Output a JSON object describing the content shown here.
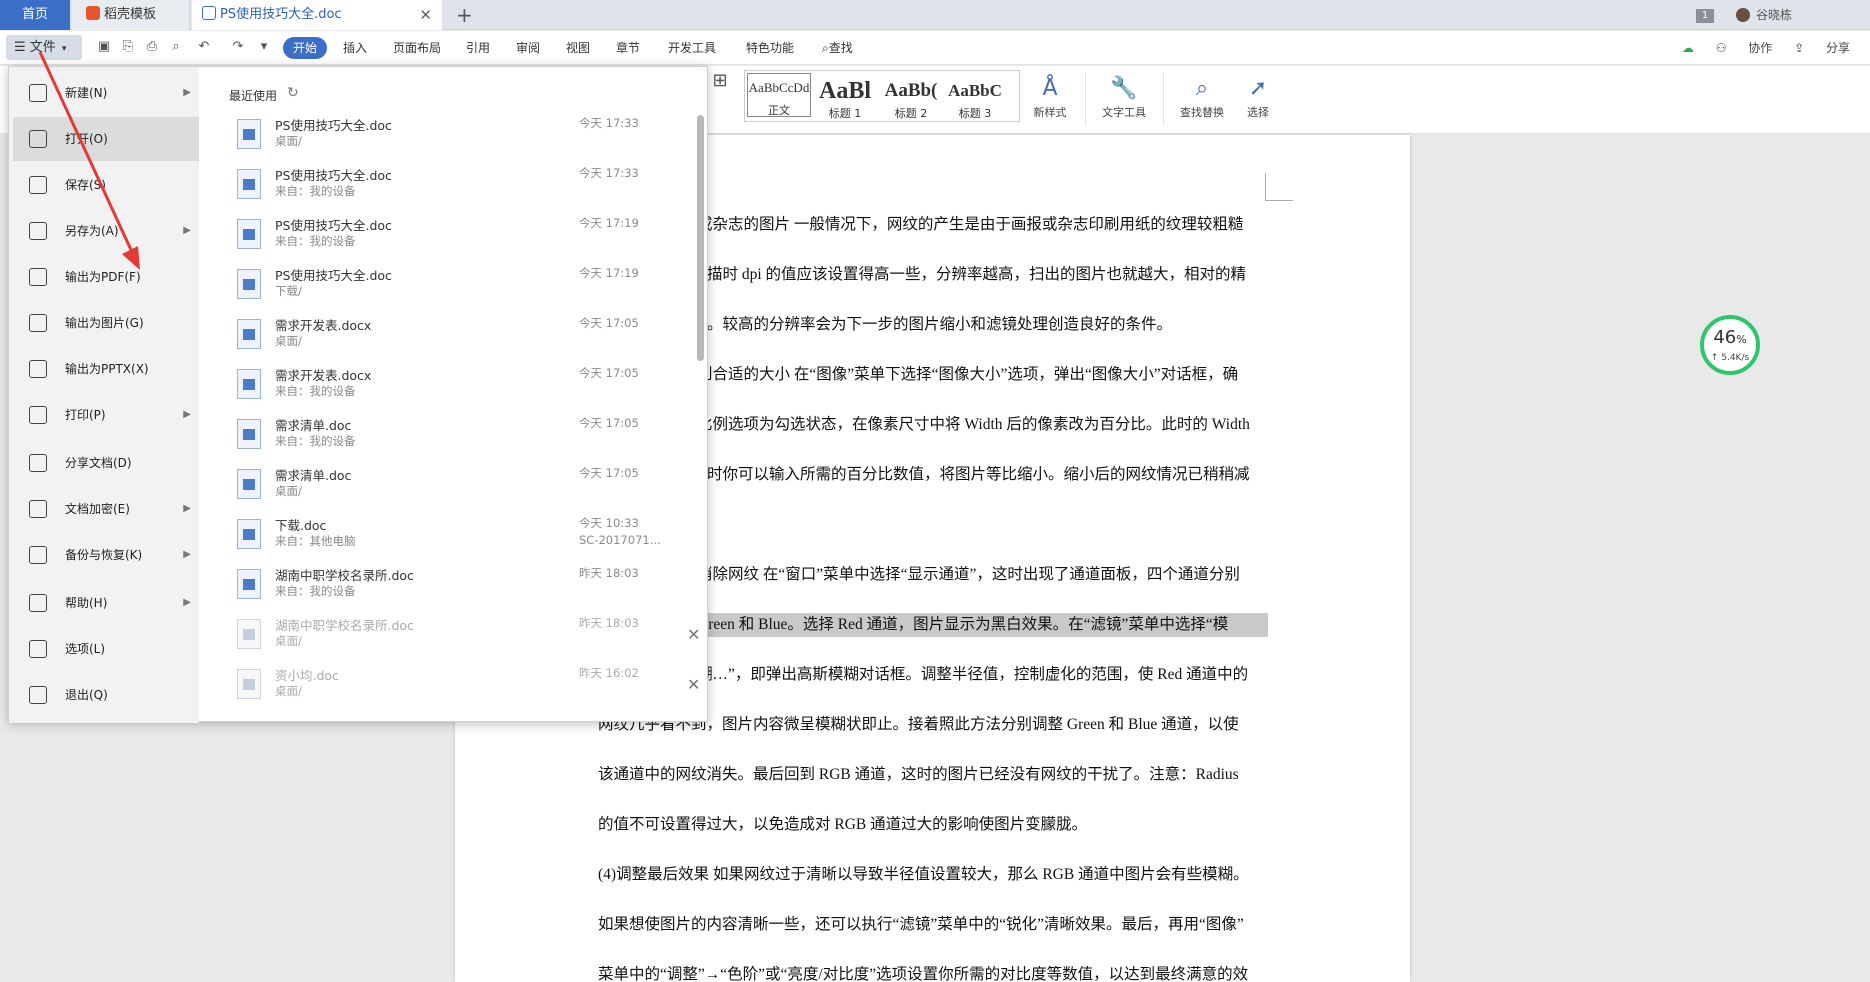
{
  "tabs": {
    "home": "首页",
    "template": "稻壳模板",
    "doc": "PS使用技巧大全.doc"
  },
  "window": {
    "badge": "1",
    "user": "谷晓栋"
  },
  "menubar": {
    "file": "文件",
    "tabs": [
      "开始",
      "插入",
      "页面布局",
      "引用",
      "审阅",
      "视图",
      "章节",
      "开发工具",
      "特色功能",
      "查找"
    ],
    "right": [
      "协作",
      "分享"
    ]
  },
  "ribbon": {
    "styles": [
      {
        "preview": "AaBbCcDd",
        "label": "正文"
      },
      {
        "preview": "AaBl",
        "label": "标题 1"
      },
      {
        "preview": "AaBb(",
        "label": "标题 2"
      },
      {
        "preview": "AaBbC",
        "label": "标题 3"
      }
    ],
    "new_style": "新样式",
    "text_tools": "文字工具",
    "find_replace": "查找替换",
    "select": "选择"
  },
  "file_menu": {
    "items": [
      {
        "label": "新建(N)",
        "arrow": true
      },
      {
        "label": "打开(O)",
        "arrow": false,
        "active": true
      },
      {
        "label": "保存(S)",
        "arrow": false
      },
      {
        "label": "另存为(A)",
        "arrow": true
      },
      {
        "label": "输出为PDF(F)",
        "arrow": false
      },
      {
        "label": "输出为图片(G)",
        "arrow": false
      },
      {
        "label": "输出为PPTX(X)",
        "arrow": false
      },
      {
        "label": "打印(P)",
        "arrow": true
      },
      {
        "label": "分享文档(D)",
        "arrow": false
      },
      {
        "label": "文档加密(E)",
        "arrow": true
      },
      {
        "label": "备份与恢复(K)",
        "arrow": true
      },
      {
        "label": "帮助(H)",
        "arrow": true
      },
      {
        "label": "选项(L)",
        "arrow": false
      },
      {
        "label": "退出(Q)",
        "arrow": false
      }
    ],
    "recent_title": "最近使用",
    "recent": [
      {
        "name": "PS使用技巧大全.doc",
        "loc": "桌面/",
        "time": "今天 17:33",
        "sub": ""
      },
      {
        "name": "PS使用技巧大全.doc",
        "loc": "来自：我的设备",
        "time": "今天 17:33",
        "sub": ""
      },
      {
        "name": "PS使用技巧大全.doc",
        "loc": "来自：我的设备",
        "time": "今天 17:19",
        "sub": ""
      },
      {
        "name": "PS使用技巧大全.doc",
        "loc": "下载/",
        "time": "今天 17:19",
        "sub": ""
      },
      {
        "name": "需求开发表.docx",
        "loc": "桌面/",
        "time": "今天 17:05",
        "sub": ""
      },
      {
        "name": "需求开发表.docx",
        "loc": "来自：我的设备",
        "time": "今天 17:05",
        "sub": ""
      },
      {
        "name": "需求清单.doc",
        "loc": "来自：我的设备",
        "time": "今天 17:05",
        "sub": ""
      },
      {
        "name": "需求清单.doc",
        "loc": "桌面/",
        "time": "今天 17:05",
        "sub": ""
      },
      {
        "name": "下载.doc",
        "loc": "来自：其他电脑",
        "time": "今天 10:33",
        "sub": "SC-2017071..."
      },
      {
        "name": "湖南中职学校名录所.doc",
        "loc": "来自：我的设备",
        "time": "昨天 18:03",
        "sub": ""
      },
      {
        "name": "湖南中职学校名录所.doc",
        "loc": "桌面/",
        "time": "昨天 18:03",
        "sub": "",
        "faded": true
      },
      {
        "name": "资小均.doc",
        "loc": "桌面/",
        "time": "昨天 16:02",
        "sub": "",
        "faded": true
      }
    ]
  },
  "document": {
    "lines": [
      "或杂志的图片  一般情况下，网纹的产生是由于画报或杂志印刷用纸的纹理较粗糙",
      "描时 dpi 的值应该设置得高一些，分辨率越高，扫出的图片也就越大，相对的精",
      "。较高的分辨率会为下一步的图片缩小和滤镜处理创造良好的条件。",
      "到合适的大小  在“图像”菜单下选择“图像大小”选项，弹出“图像大小”对话框，确",
      "比例选项为勾选状态，在像素尺寸中将 Width 后的像素改为百分比。此时的 Width",
      "时你可以输入所需的百分比数值，将图片等比缩小。缩小后的网纹情况已稍稍减",
      "",
      "消除网纹  在“窗口”菜单中选择“显示通道”，这时出现了通道面板，四个通道分别",
      "Green 和 Blue。选择 Red 通道，图片显示为黑白效果。在“滤镜”菜单中选择“模",
      "糊…”，即弹出高斯模糊对话框。调整半径值，控制虚化的范围，使 Red 通道中的",
      "网纹几乎看不到，图片内容微呈模糊状即止。接着照此方法分别调整 Green 和 Blue 通道，以使",
      "该通道中的网纹消失。最后回到 RGB 通道，这时的图片已经没有网纹的干扰了。注意：Radius",
      "的值不可设置得过大，以免造成对 RGB 通道过大的影响使图片变朦胧。",
      "(4)调整最后效果  如果网纹过于清晰以导致半径值设置较大，那么 RGB 通道中图片会有些模糊。",
      "如果想使图片的内容清晰一些，还可以执行“滤镜”菜单中的“锐化”清晰效果。最后，再用“图像”",
      "菜单中的“调整”→“色阶”或“亮度/对比度”选项设置你所需的对比度等数值，以达到最终满意的效"
    ]
  },
  "speed": {
    "percent": "46",
    "pct_sign": "%",
    "rate": "↑ 5.4K/s"
  },
  "colors": {
    "accent": "#3a6ec7",
    "arrow": "#e53935",
    "speed_ring": "#2fc56a"
  }
}
